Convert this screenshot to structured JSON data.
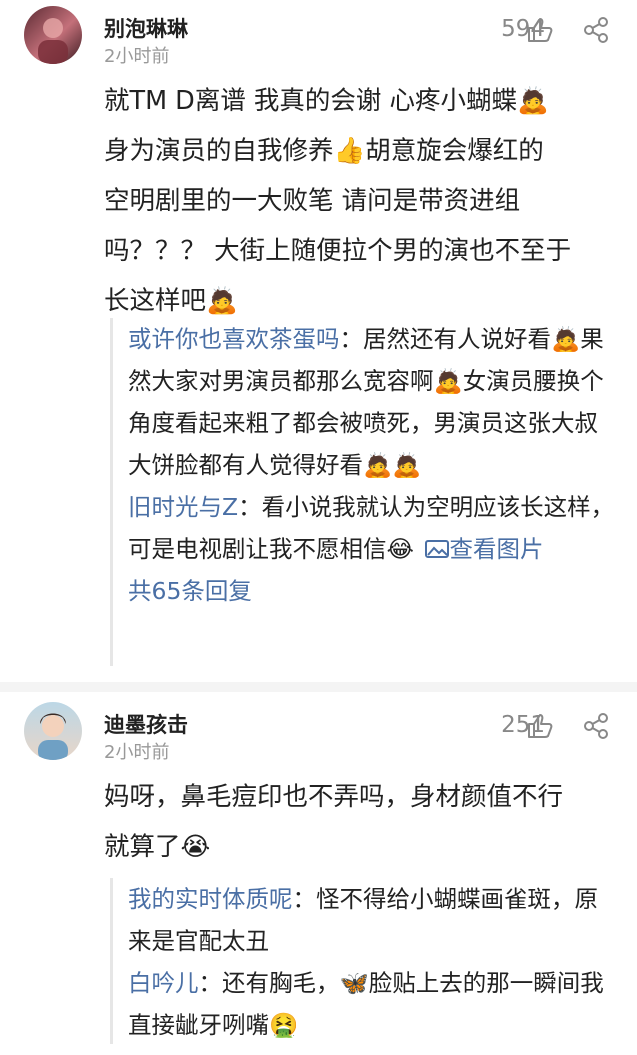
{
  "comments": [
    {
      "username": "别泡琳琳",
      "time": "2小时前",
      "likes": "594",
      "text_lines": [
        "就TM D离谱 我真的会谢 心疼小蝴蝶🙇",
        "身为演员的自我修养👍胡意旋会爆红的",
        "空明剧里的一大败笔 请问是带资进组",
        "吗？？？ 大街上随便拉个男的演也不至于",
        "长这样吧🙇"
      ],
      "replies": [
        {
          "name": "或许你也喜欢茶蛋吗",
          "text": "：居然还有人说好看🙇果然大家对男演员都那么宽容啊🙇女演员腰换个角度看起来粗了都会被喷死，男演员这张大叔大饼脸都有人觉得好看🙇🙇"
        },
        {
          "name": "旧时光与Z",
          "text": "：看小说我就认为空明应该长这样，可是电视剧让我不愿相信😂",
          "link": "查看图片"
        }
      ],
      "reply_count": "共65条回复"
    },
    {
      "username": "迪墨孩击",
      "time": "2小时前",
      "likes": "251",
      "text_lines": [
        "妈呀，鼻毛痘印也不弄吗，身材颜值不行",
        "就算了😭"
      ],
      "replies": [
        {
          "name": "我的实时体质呢",
          "text": "：怪不得给小蝴蝶画雀斑，原来是官配太丑"
        },
        {
          "name": "白吟儿",
          "text": "：还有胸毛，🦋脸贴上去的那一瞬间我直接龇牙咧嘴🤮"
        }
      ]
    }
  ],
  "icons": {
    "like": "thumbs-up-icon",
    "share": "share-icon",
    "image": "image-icon"
  },
  "colors": {
    "link": "#4a6fa5",
    "username": "#222222",
    "meta": "#999999"
  }
}
